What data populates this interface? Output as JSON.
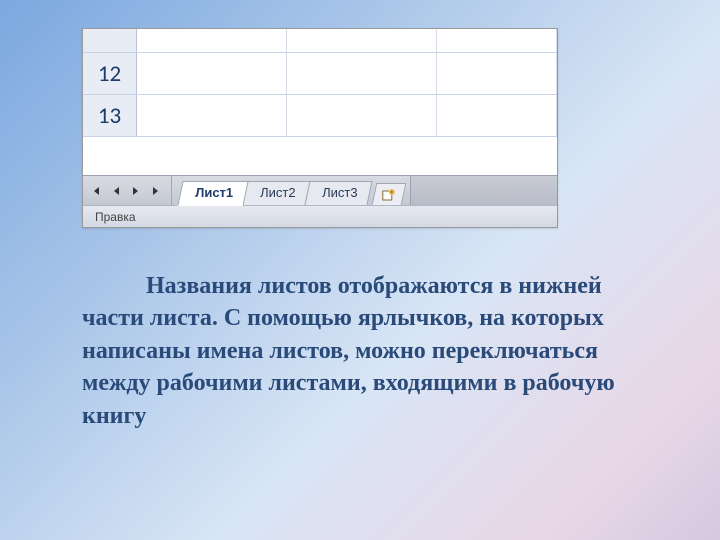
{
  "spreadsheet": {
    "visible_rows": [
      "",
      "12",
      "13"
    ],
    "nav_icons": [
      "first",
      "prev",
      "next",
      "last"
    ],
    "tabs": [
      {
        "label": "Лист1",
        "active": true
      },
      {
        "label": "Лист2",
        "active": false
      },
      {
        "label": "Лист3",
        "active": false
      }
    ],
    "new_sheet_icon": "new-sheet",
    "status": "Правка"
  },
  "body": {
    "text": "Названия листов отображаются в нижней части листа. С помощью ярлычков, на которых написаны имена листов, можно переключаться между рабочими листами, входящими в рабочую книгу"
  }
}
